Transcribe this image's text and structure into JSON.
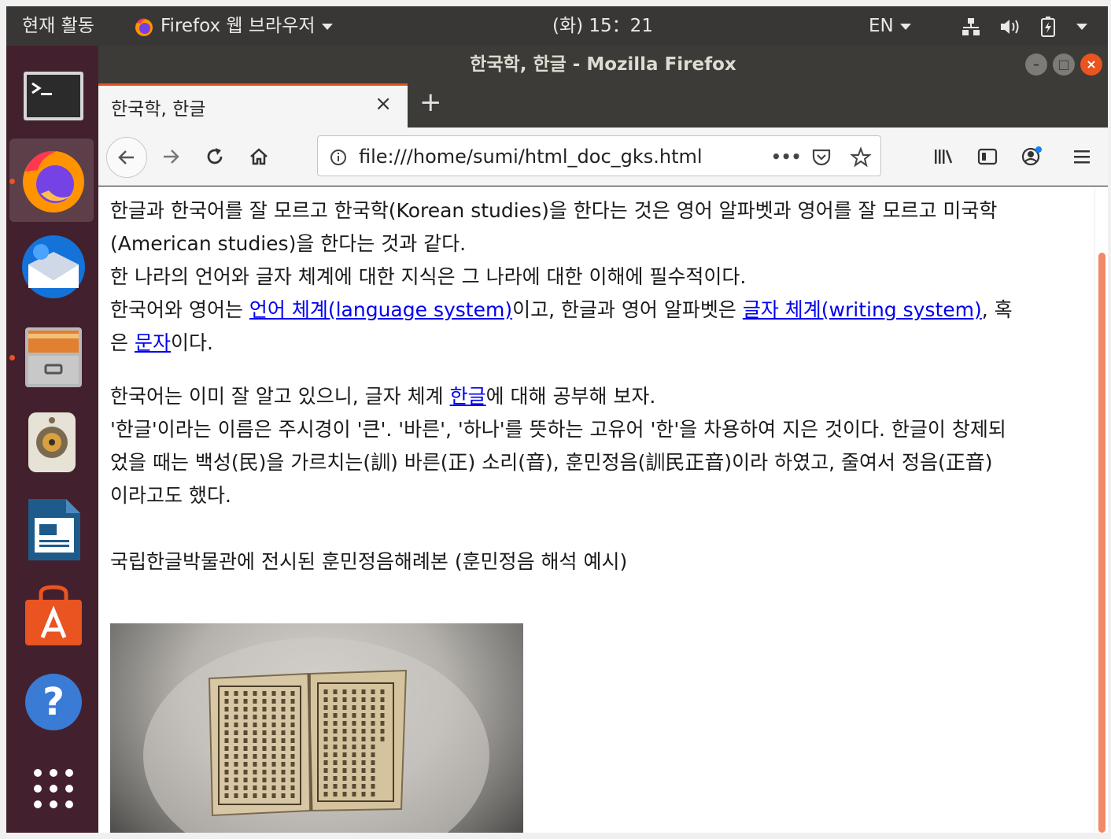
{
  "topbar": {
    "activities": "현재 활동",
    "app_menu": "Firefox 웹 브라우저",
    "clock": "(화) 15：21",
    "language": "EN"
  },
  "dock": {
    "items": [
      "terminal-icon",
      "firefox-icon",
      "thunderbird-icon",
      "files-icon",
      "rhythmbox-icon",
      "libreoffice-impress-icon",
      "software-center-icon",
      "help-icon",
      "show-apps-icon"
    ]
  },
  "window": {
    "title": "한국학, 한글 - Mozilla Firefox"
  },
  "tab": {
    "title": "한국학, 한글",
    "close_label": "×",
    "new_tab_label": "+"
  },
  "navbar": {
    "url": "file:///home/sumi/html_doc_gks.html",
    "page_actions": "•••"
  },
  "content": {
    "para1": {
      "line1": "한글과 한국어를 잘 모르고 한국학(Korean studies)을 한다는 것은 영어 알파벳과 영어를 잘 모르고 미국학",
      "line2": "(American studies)을 한다는 것과 같다.",
      "line3": "한 나라의 언어와 글자 체계에 대한 지식은 그 나라에 대한 이해에 필수적이다.",
      "line4_a": "한국어와 영어는 ",
      "link_language": "언어 체계(language system)",
      "line4_b": "이고, 한글과 영어 알파벳은 ",
      "link_writing": "글자 체계(writing system)",
      "line4_c": ", 혹",
      "line5_a": "은 ",
      "link_script": "문자",
      "line5_b": "이다."
    },
    "para2": {
      "line1_a": "한국어는 이미 잘 알고 있으니, 글자 체계 ",
      "link_hangul": "한글",
      "line1_b": "에 대해 공부해 보자.",
      "line2": "'한글'이라는 이름은 주시경이 '큰'. '바른', '하나'를 뜻하는 고유어 '한'을 차용하여 지은 것이다. 한글이 창제되",
      "line3": "었을 때는 백성(民)을 가르치는(訓) 바른(正) 소리(音), 훈민정음(訓民正音)이라 하였고, 줄여서 정음(正音)",
      "line4": "이라고도 했다."
    },
    "caption": "국립한글박물관에 전시된 훈민정음해례본 (훈민정음 해석 예시)"
  }
}
